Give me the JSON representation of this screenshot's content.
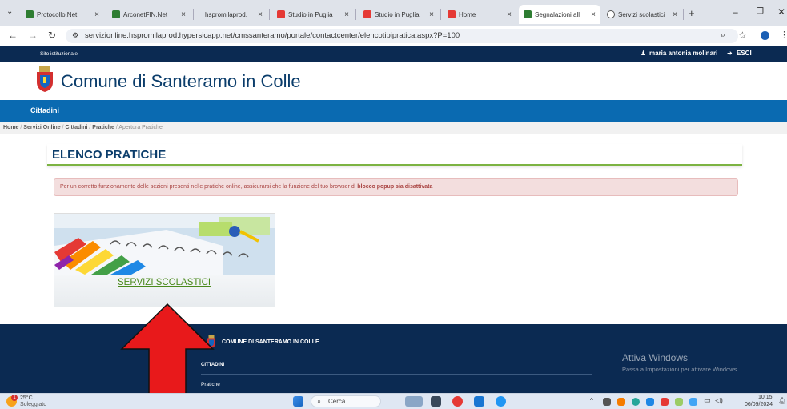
{
  "browser": {
    "tabs": [
      {
        "label": "Protocollo.Net",
        "close": "×",
        "color": "#2e7d32"
      },
      {
        "label": "ArconetFIN.Net",
        "close": "×",
        "color": "#2e7d32"
      },
      {
        "label": "hspromilaprod.",
        "close": "×",
        "color": "#ffffff"
      },
      {
        "label": "Studio in Puglia",
        "close": "×",
        "color": "#e53935"
      },
      {
        "label": "Studio in Puglia",
        "close": "×",
        "color": "#e53935"
      },
      {
        "label": "Home",
        "close": "×",
        "color": "#e53935"
      },
      {
        "label": "Segnalazioni all",
        "close": "×",
        "color": "#2e7d32"
      },
      {
        "label": "Servizi scolastici",
        "close": "×",
        "color": "#555555"
      }
    ],
    "new_tab": "+",
    "url": "servizionline.hspromilaprod.hypersicapp.net/cmssanteramo/portale/contactcenter/elencotipipratica.aspx?P=100"
  },
  "site": {
    "top_left": "Sito istituzionale",
    "user_name": "maria antonia molinari",
    "logout": "ESCI",
    "title": "Comune di Santeramo in Colle",
    "menu_item": "Cittadini",
    "breadcrumb": [
      "Home",
      "Servizi Online",
      "Cittadini",
      "Pratiche",
      "Apertura Pratiche"
    ],
    "page_title": "ELENCO PRATICHE",
    "alert_text": "Per un corretto funzionamento delle sezioni presenti nelle pratiche online, assicurarsi che la funzione del tuo browser di ",
    "alert_bold": "blocco popup sia disattivata",
    "card_label": "SERVIZI SCOLASTICI",
    "footer_title": "COMUNE DI SANTERAMO IN COLLE",
    "footer_section": "CITTADINI",
    "footer_link": "Pratiche"
  },
  "windows": {
    "activate_title": "Attiva Windows",
    "activate_sub": "Passa a Impostazioni per attivare Windows.",
    "weather_temp": "25°C",
    "weather_desc": "Soleggiato",
    "weather_badge": "1",
    "search_label": "Cerca",
    "time": "10:15",
    "date": "06/09/2024"
  },
  "colors": {
    "accent_blue": "#0a6ab1",
    "navy": "#0b2a52",
    "green": "#7cb342",
    "arrow_red": "#e8191b"
  }
}
